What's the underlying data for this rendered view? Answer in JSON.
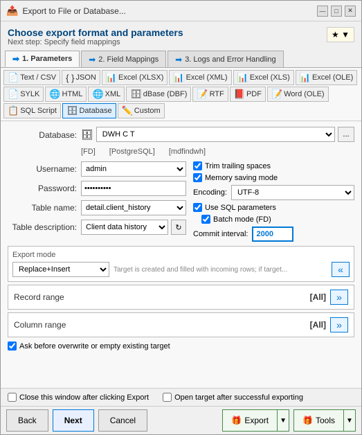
{
  "window": {
    "title": "Export to File or Database..."
  },
  "header": {
    "title": "Choose export format and parameters",
    "subtitle": "Next step: Specify field mappings",
    "fav_btn": "★ ▼"
  },
  "tabs": [
    {
      "id": "parameters",
      "label": "1. Parameters",
      "active": true
    },
    {
      "id": "field_mappings",
      "label": "2. Field Mappings",
      "active": false
    },
    {
      "id": "logs",
      "label": "3. Logs and Error Handling",
      "active": false
    }
  ],
  "toolbar": {
    "formats": [
      {
        "id": "text_csv",
        "icon": "📄",
        "label": "Text / CSV"
      },
      {
        "id": "json",
        "icon": "{ }",
        "label": "JSON"
      },
      {
        "id": "excel_xlsx",
        "icon": "📊",
        "label": "Excel (XLSX)"
      },
      {
        "id": "excel_xml",
        "icon": "📊",
        "label": "Excel (XML)"
      },
      {
        "id": "excel_xls",
        "icon": "📊",
        "label": "Excel (XLS)"
      },
      {
        "id": "excel_ole",
        "icon": "📊",
        "label": "Excel (OLE)"
      },
      {
        "id": "sylk",
        "icon": "📄",
        "label": "SYLK"
      },
      {
        "id": "html",
        "icon": "🌐",
        "label": "HTML"
      },
      {
        "id": "xml",
        "icon": "🌐",
        "label": "XML"
      },
      {
        "id": "dbase_dbf",
        "icon": "🗄",
        "label": "dBase (DBF)"
      },
      {
        "id": "rtf",
        "icon": "📝",
        "label": "RTF"
      },
      {
        "id": "pdf",
        "icon": "📕",
        "label": "PDF"
      },
      {
        "id": "word_ole",
        "icon": "📝",
        "label": "Word (OLE)"
      },
      {
        "id": "sql_script",
        "icon": "📋",
        "label": "SQL Script"
      },
      {
        "id": "database",
        "icon": "🗄",
        "label": "Database",
        "active": true
      },
      {
        "id": "custom",
        "icon": "✏️",
        "label": "Custom"
      }
    ]
  },
  "form": {
    "database_label": "Database:",
    "database_value": "DWH C T",
    "database_meta": {
      "fd": "[FD]",
      "postgresql": "[PostgreSQL]",
      "mdfindwh": "[mdfindwh]"
    },
    "username_label": "Username:",
    "username_value": "admin",
    "password_label": "Password:",
    "password_value": "••••••••••",
    "table_name_label": "Table name:",
    "table_name_value": "detail.client_history",
    "table_desc_label": "Table description:",
    "table_desc_value": "Client data history",
    "right_options": {
      "trim_trailing": "Trim trailing spaces",
      "memory_saving": "Memory saving mode",
      "encoding_label": "Encoding:",
      "encoding_value": "UTF-8",
      "use_sql_params": "Use SQL parameters",
      "batch_mode": "Batch mode (FD)",
      "commit_interval_label": "Commit interval:",
      "commit_interval_value": "2000"
    },
    "export_mode": {
      "section_label": "Export mode",
      "value": "Replace+Insert",
      "description": "Target is created and filled with incoming rows; if target..."
    },
    "record_range": {
      "label": "Record range",
      "value": "[All]"
    },
    "column_range": {
      "label": "Column range",
      "value": "[All]"
    },
    "overwrite_label": "Ask before overwrite or empty existing target"
  },
  "footer": {
    "close_after_export": "Close this window after clicking Export",
    "open_after_export": "Open target after successful exporting",
    "back_btn": "Back",
    "next_btn": "Next",
    "cancel_btn": "Cancel",
    "export_btn": "Export",
    "tools_btn": "Tools"
  }
}
